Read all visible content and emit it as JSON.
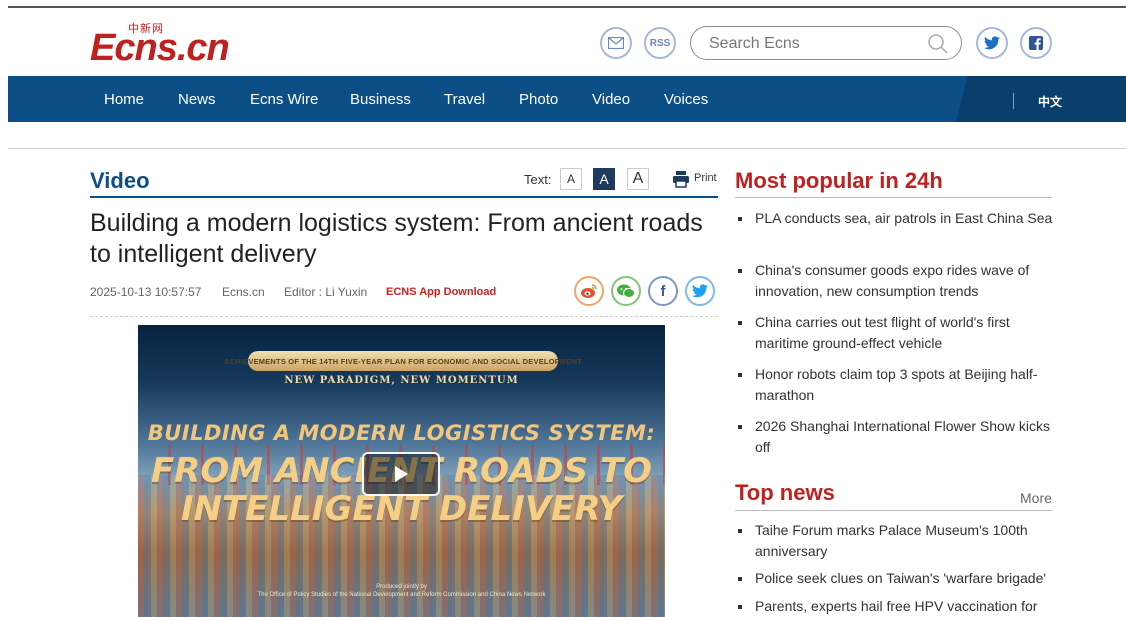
{
  "header": {
    "logo_small": "中新网",
    "logo_brand": "Ecns.cn",
    "search_placeholder": "Search Ecns",
    "rss_label": "RSS"
  },
  "nav": {
    "items": [
      "Home",
      "News",
      "Ecns Wire",
      "Business",
      "Travel",
      "Photo",
      "Video",
      "Voices"
    ],
    "lang": "中文"
  },
  "article": {
    "section": "Video",
    "text_label": "Text:",
    "size_small": "A",
    "size_medium": "A",
    "size_large": "A",
    "print_label": "Print",
    "title": "Building a modern logistics system: From ancient roads to intelligent delivery",
    "date": "2025-10-13 10:57:57",
    "source": "Ecns.cn",
    "editor": "Editor : Li Yuxin",
    "app_download": "ECNS App Download"
  },
  "video": {
    "banner": "ACHIEVEMENTS OF THE 14TH FIVE-YEAR PLAN FOR ECONOMIC AND SOCIAL DEVELOPMENT",
    "subtitle": "NEW PARADIGM, NEW MOMENTUM",
    "line1": "BUILDING A MODERN LOGISTICS SYSTEM:",
    "line2": "FROM ANCIENT ROADS TO",
    "line3": "INTELLIGENT DELIVERY",
    "credit1": "Produced jointly by",
    "credit2": "The Office of Policy Studies of the National Development and Reform Commission and China News Network"
  },
  "most_popular": {
    "title": "Most popular in 24h",
    "items": [
      "PLA conducts sea, air patrols in East China Sea",
      "China's consumer goods expo rides wave of innovation, new consumption trends",
      "China carries out test flight of world's first maritime ground-effect vehicle",
      "Honor robots claim top 3 spots at Beijing half-marathon",
      "2026 Shanghai International Flower Show kicks off"
    ]
  },
  "top_news": {
    "title": "Top news",
    "more": "More",
    "items": [
      "Taihe Forum marks Palace Museum's 100th anniversary",
      "Police seek clues on Taiwan's 'warfare brigade'",
      "Parents, experts hail free HPV vaccination for"
    ]
  },
  "colors": {
    "brand_red": "#c0201f",
    "nav_blue": "#0c4e86"
  }
}
